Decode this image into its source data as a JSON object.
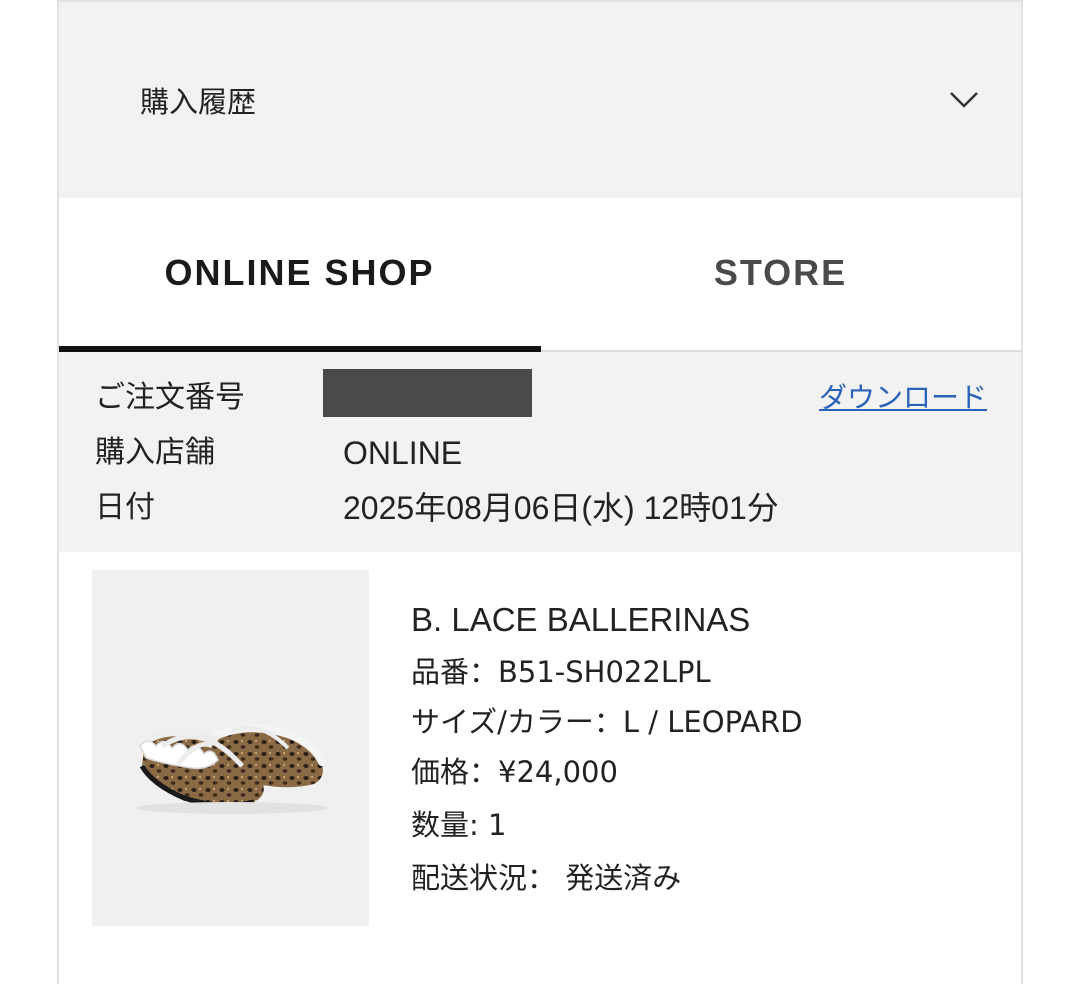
{
  "accordion": {
    "title": "購入履歴",
    "icon": "chevron-down-icon"
  },
  "tabs": [
    {
      "label": "ONLINE SHOP",
      "active": true
    },
    {
      "label": "STORE",
      "active": false
    }
  ],
  "order": {
    "number_label": "ご注文番号",
    "number_value": "",
    "download_label": "ダウンロード",
    "store_label": "購入店舗",
    "store_value": "ONLINE",
    "date_label": "日付",
    "date_value": "2025年08月06日(水) 12時01分"
  },
  "product": {
    "name": "B. LACE BALLERINAS",
    "item_number": "品番：B51-SH022LPL",
    "size_color": "サイズ/カラー：L / LEOPARD",
    "price": "価格：¥24,000",
    "quantity": "数量: 1",
    "shipping_status": "配送状況： 発送済み"
  },
  "colors": {
    "header_bg": "#f2f2f2",
    "link": "#2a62b8",
    "tab_active": "#111111",
    "redaction": "#4a4a4a"
  }
}
